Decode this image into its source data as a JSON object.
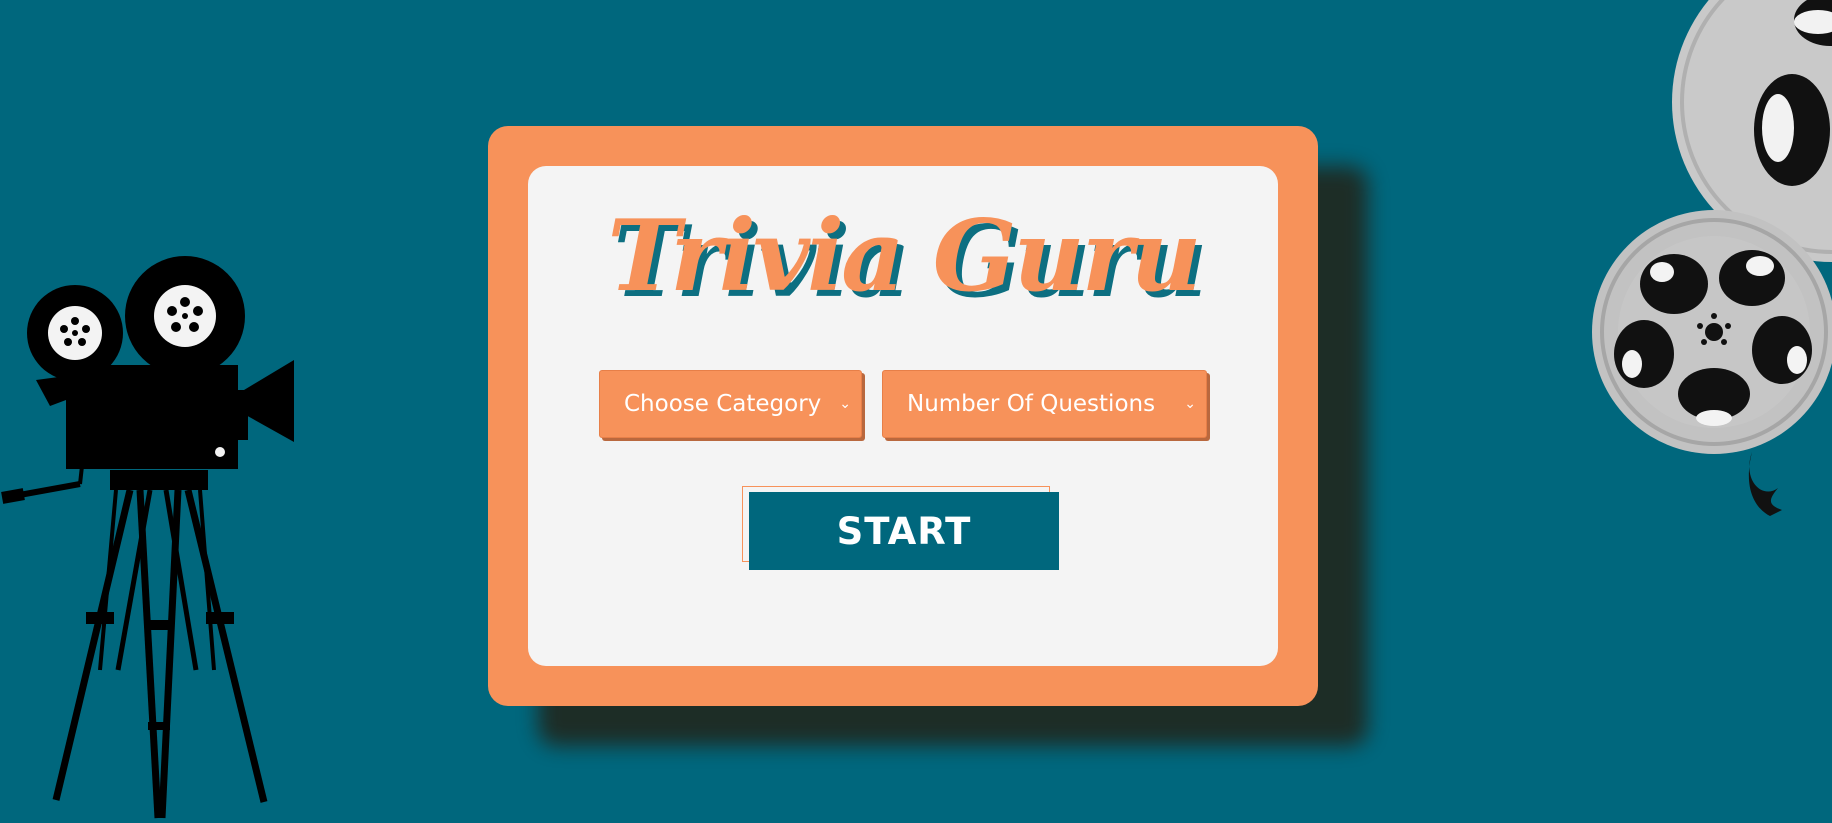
{
  "app": {
    "title": "Trivia Guru"
  },
  "controls": {
    "category": {
      "label": "Choose Category",
      "chevron": "⌄"
    },
    "questions": {
      "label": "Number Of Questions",
      "chevron": "⌄"
    },
    "start_label": "START"
  },
  "theme": {
    "background": "#00677d",
    "accent": "#f7925a",
    "panel": "#f4f4f4",
    "title_shadow": "#0d6f81"
  },
  "decor": {
    "left_icon": "movie-camera-icon",
    "right_icon": "film-reel-icon"
  }
}
